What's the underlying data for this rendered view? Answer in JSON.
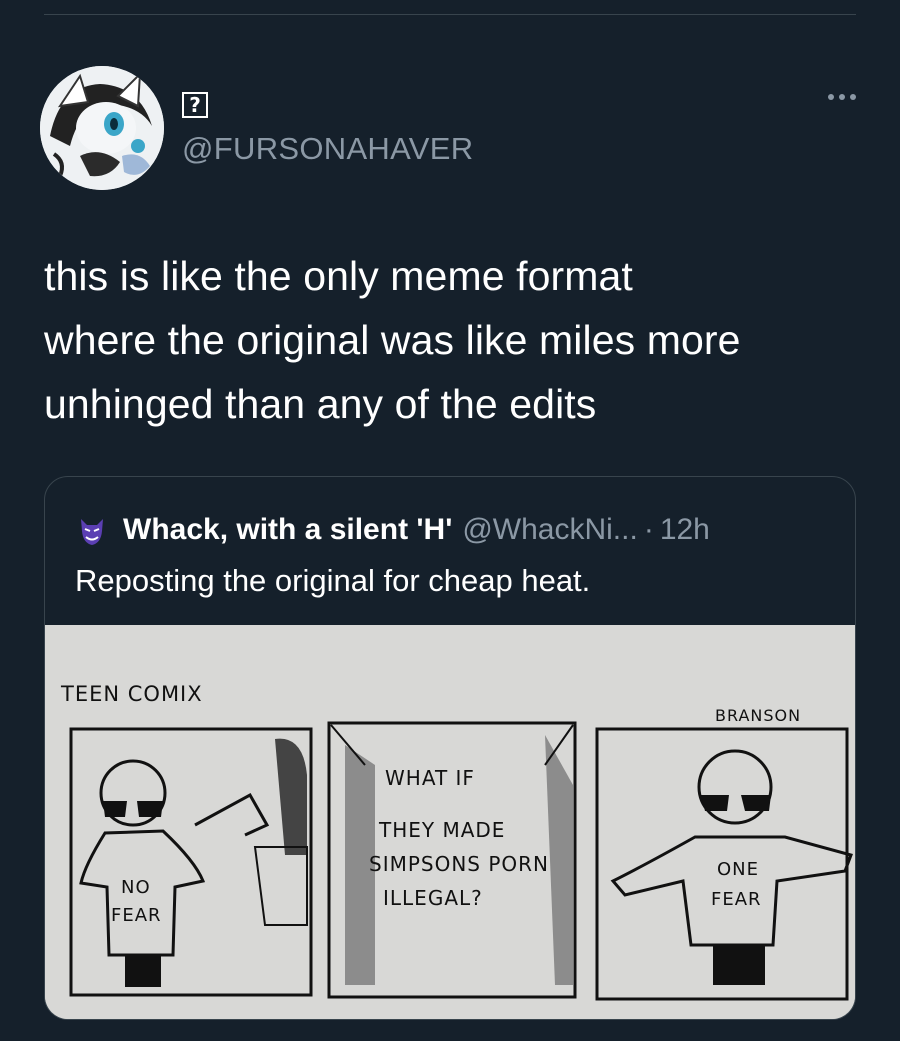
{
  "author": {
    "display_name_glyph": "?",
    "handle": "@FURSONAHAVER",
    "avatar_icon": "anime-character-avatar"
  },
  "tweet": {
    "text": "this is like the only meme format\nwhere the original was like miles more\nunhinged than any of the edits"
  },
  "quoted_tweet": {
    "author_name": "Whack, with a silent 'H'",
    "author_handle": "@WhackNi...",
    "separator": "·",
    "time": "12h",
    "text": "Reposting the original for cheap heat.",
    "avatar_icon": "purple-character-avatar"
  },
  "comic": {
    "title": "TEEN COMIX",
    "signature": "BRANSON",
    "panel1_shirt_line1": "NO",
    "panel1_shirt_line2": "FEAR",
    "panel2_sign": [
      "WHAT IF",
      "THEY MADE",
      "SIMPSONS PORN",
      "ILLEGAL?"
    ],
    "panel3_shirt_line1": "ONE",
    "panel3_shirt_line2": "FEAR"
  },
  "colors": {
    "background": "#15202b",
    "secondary_text": "#8b98a5",
    "border": "#38444d"
  }
}
